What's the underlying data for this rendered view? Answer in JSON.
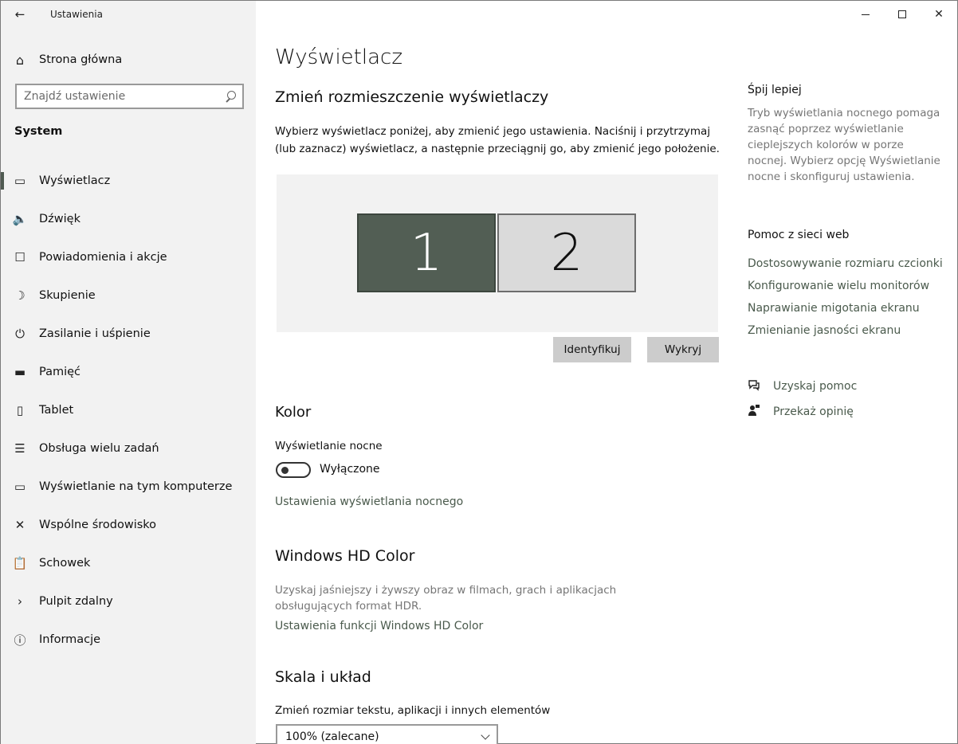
{
  "window": {
    "app_title": "Ustawienia",
    "back_icon": "←",
    "close_icon": "✕"
  },
  "sidebar": {
    "home": {
      "label": "Strona główna",
      "icon": "⌂"
    },
    "search": {
      "placeholder": "Znajdź ustawienie"
    },
    "section": "System",
    "items": [
      {
        "label": "Wyświetlacz",
        "icon": "▭",
        "active": true
      },
      {
        "label": "Dźwięk",
        "icon": "🔈"
      },
      {
        "label": "Powiadomienia i akcje",
        "icon": "☐"
      },
      {
        "label": "Skupienie",
        "icon": "☽"
      },
      {
        "label": "Zasilanie i uśpienie",
        "icon": "⏻"
      },
      {
        "label": "Pamięć",
        "icon": "▬"
      },
      {
        "label": "Tablet",
        "icon": "▯"
      },
      {
        "label": "Obsługa wielu zadań",
        "icon": "☰"
      },
      {
        "label": "Wyświetlanie na tym komputerze",
        "icon": "▭"
      },
      {
        "label": "Wspólne środowisko",
        "icon": "✕"
      },
      {
        "label": "Schowek",
        "icon": "📋"
      },
      {
        "label": "Pulpit zdalny",
        "icon": "›"
      },
      {
        "label": "Informacje",
        "icon": "ⓘ"
      }
    ]
  },
  "main": {
    "title": "Wyświetlacz",
    "arrange_heading": "Zmień rozmieszczenie wyświetlaczy",
    "arrange_desc": "Wybierz wyświetlacz poniżej, aby zmienić jego ustawienia. Naciśnij i przytrzymaj (lub zaznacz) wyświetlacz, a następnie przeciągnij go, aby zmienić jego położenie.",
    "monitors": [
      "1",
      "2"
    ],
    "identify_button": "Identyfikuj",
    "detect_button": "Wykryj",
    "color_heading": "Kolor",
    "night_light_label": "Wyświetlanie nocne",
    "night_light_state": "Wyłączone",
    "night_light_settings_link": "Ustawienia wyświetlania nocnego",
    "hd_heading": "Windows HD Color",
    "hd_desc": "Uzyskaj jaśniejszy i żywszy obraz w filmach, grach i aplikacjach obsługujących format HDR.",
    "hd_link": "Ustawienia funkcji Windows HD Color",
    "scale_heading": "Skala i układ",
    "scale_label": "Zmień rozmiar tekstu, aplikacji i innych elementów",
    "scale_value": "100% (zalecane)"
  },
  "aside": {
    "sleep_heading": "Śpij lepiej",
    "sleep_desc": "Tryb wyświetlania nocnego pomaga zasnąć poprzez wyświetlanie cieplejszych kolorów w porze nocnej. Wybierz opcję Wyświetlanie nocne i skonfiguruj ustawienia.",
    "web_help_heading": "Pomoc z sieci web",
    "web_links": [
      "Dostosowywanie rozmiaru czcionki",
      "Konfigurowanie wielu monitorów",
      "Naprawianie migotania ekranu",
      "Zmienianie jasności ekranu"
    ],
    "get_help": "Uzyskaj pomoc",
    "feedback": "Przekaż opinię"
  }
}
